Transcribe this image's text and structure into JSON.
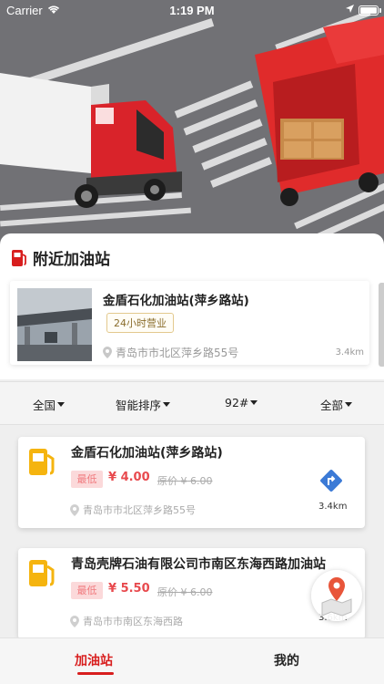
{
  "status_bar": {
    "carrier": "Carrier",
    "time": "1:19 PM"
  },
  "nearby": {
    "title": "附近加油站",
    "station": {
      "name": "金盾石化加油站(萍乡路站)",
      "hours_tag": "24小时营业",
      "address": "青岛市市北区萍乡路55号",
      "distance": "3.4km"
    }
  },
  "filters": [
    {
      "label": "全国"
    },
    {
      "label": "智能排序"
    },
    {
      "label": "92#"
    },
    {
      "label": "全部"
    }
  ],
  "stations": [
    {
      "name": "金盾石化加油站(萍乡路站)",
      "low_label": "最低",
      "price": "¥ 4.00",
      "orig_label": "原价",
      "orig_price": "¥ 6.00",
      "address": "青岛市市北区萍乡路55号",
      "distance": "3.4km"
    },
    {
      "name": "青岛壳牌石油有限公司市南区东海西路加油站",
      "low_label": "最低",
      "price": "¥ 5.50",
      "orig_label": "原价",
      "orig_price": "¥ 6.00",
      "address": "青岛市市南区东海西路",
      "distance": "3.6km"
    }
  ],
  "tabs": [
    {
      "label": "加油站"
    },
    {
      "label": "我的"
    }
  ],
  "colors": {
    "accent": "#d81e1e",
    "price": "#e84a4e",
    "pump_yellow": "#f5b40f",
    "nav_blue": "#3b7ad6",
    "map_pin": "#e8553a"
  }
}
